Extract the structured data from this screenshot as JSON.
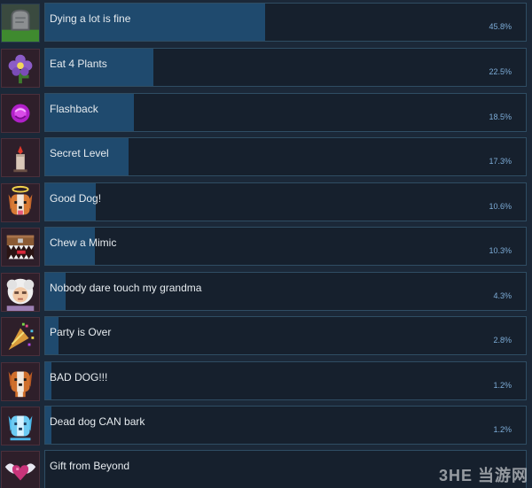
{
  "achievements": [
    {
      "name": "Dying a lot is fine",
      "percent_label": "45.8%",
      "percent": 45.8,
      "icon": "tombstone-icon"
    },
    {
      "name": "Eat 4 Plants",
      "percent_label": "22.5%",
      "percent": 22.5,
      "icon": "purple-flower-icon"
    },
    {
      "name": "Flashback",
      "percent_label": "18.5%",
      "percent": 18.5,
      "icon": "purple-orb-icon"
    },
    {
      "name": "Secret Level",
      "percent_label": "17.3%",
      "percent": 17.3,
      "icon": "candle-icon"
    },
    {
      "name": "Good Dog!",
      "percent_label": "10.6%",
      "percent": 10.6,
      "icon": "angel-dog-icon"
    },
    {
      "name": "Chew a Mimic",
      "percent_label": "10.3%",
      "percent": 10.3,
      "icon": "mimic-chest-icon"
    },
    {
      "name": "Nobody dare touch my grandma",
      "percent_label": "4.3%",
      "percent": 4.3,
      "icon": "grandma-icon"
    },
    {
      "name": "Party is Over",
      "percent_label": "2.8%",
      "percent": 2.8,
      "icon": "party-popper-icon"
    },
    {
      "name": "BAD DOG!!!",
      "percent_label": "1.2%",
      "percent": 1.2,
      "icon": "bad-dog-icon"
    },
    {
      "name": "Dead dog CAN bark",
      "percent_label": "1.2%",
      "percent": 1.2,
      "icon": "ghost-dog-icon"
    },
    {
      "name": "Gift from Beyond",
      "percent_label": "",
      "percent": 0,
      "icon": "winged-heart-icon"
    }
  ],
  "watermark": "3HE 当游网",
  "colors": {
    "background": "#1b2838",
    "bar_fill": "#1f4a6e",
    "bar_border": "#2f4d63",
    "name_text": "#e6ebef",
    "percent_text": "#7dacd7"
  }
}
